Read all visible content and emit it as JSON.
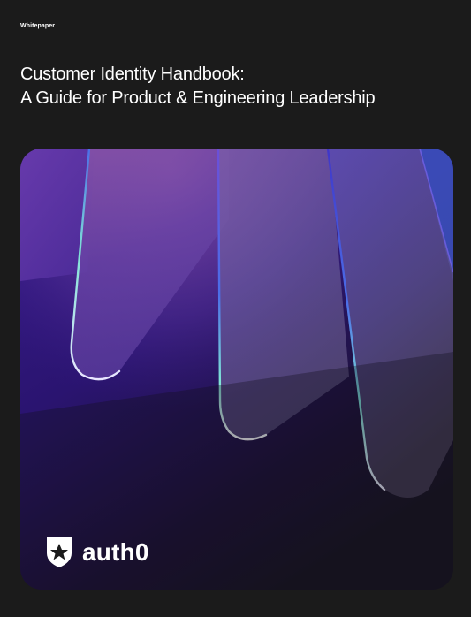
{
  "document": {
    "eyebrow": "Whitepaper",
    "title_line_1": "Customer Identity Handbook:",
    "title_line_2": "A Guide for Product & Engineering Leadership"
  },
  "brand": {
    "wordmark": "auth0",
    "logo_icon": "auth0-shield-icon"
  },
  "colors": {
    "background": "#1b1b1b",
    "text": "#ffffff",
    "art_purple_deep": "#2b1570",
    "art_violet": "#7a4fb8",
    "art_accent_cyan": "#7fe3d6",
    "art_accent_blue": "#4b6ee8"
  }
}
